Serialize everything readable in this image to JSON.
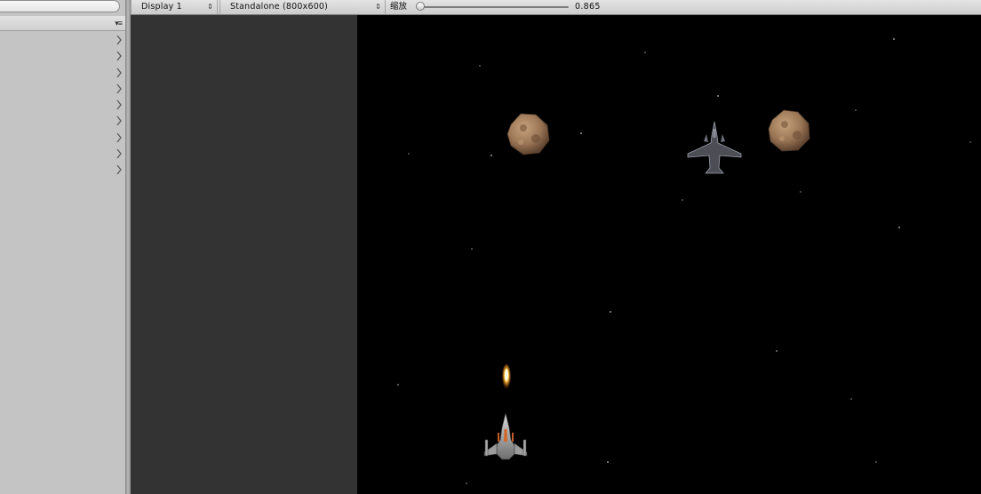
{
  "toolbar": {
    "display": "Display 1",
    "resolution": "Standalone (800x600)",
    "scale_label": "缩放",
    "scale_value": "0.865",
    "scale_fraction": 0.0
  },
  "hierarchy": {
    "row_count": 9
  },
  "icons": {
    "dropdown": "updown-arrows-icon",
    "panel_menu": "panel-menu-icon",
    "expand": "chevron-right-icon"
  },
  "colors": {
    "game_background": "#000000",
    "letterbox": "#333333",
    "panel": "#c4c4c4"
  }
}
